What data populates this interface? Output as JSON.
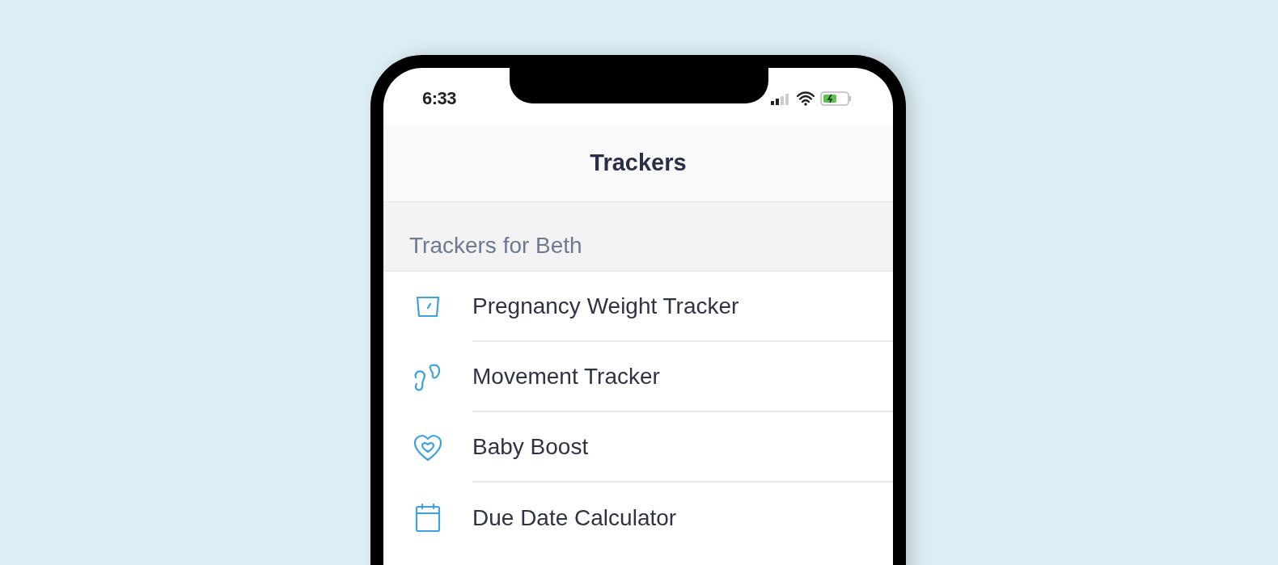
{
  "status_bar": {
    "time": "6:33"
  },
  "nav": {
    "title": "Trackers"
  },
  "section": {
    "title": "Trackers for Beth"
  },
  "items": [
    {
      "kind": "scale",
      "label": "Pregnancy Weight Tracker"
    },
    {
      "kind": "feet",
      "label": "Movement Tracker"
    },
    {
      "kind": "heart",
      "label": "Baby Boost"
    },
    {
      "kind": "calendar",
      "label": "Due Date Calculator"
    }
  ]
}
